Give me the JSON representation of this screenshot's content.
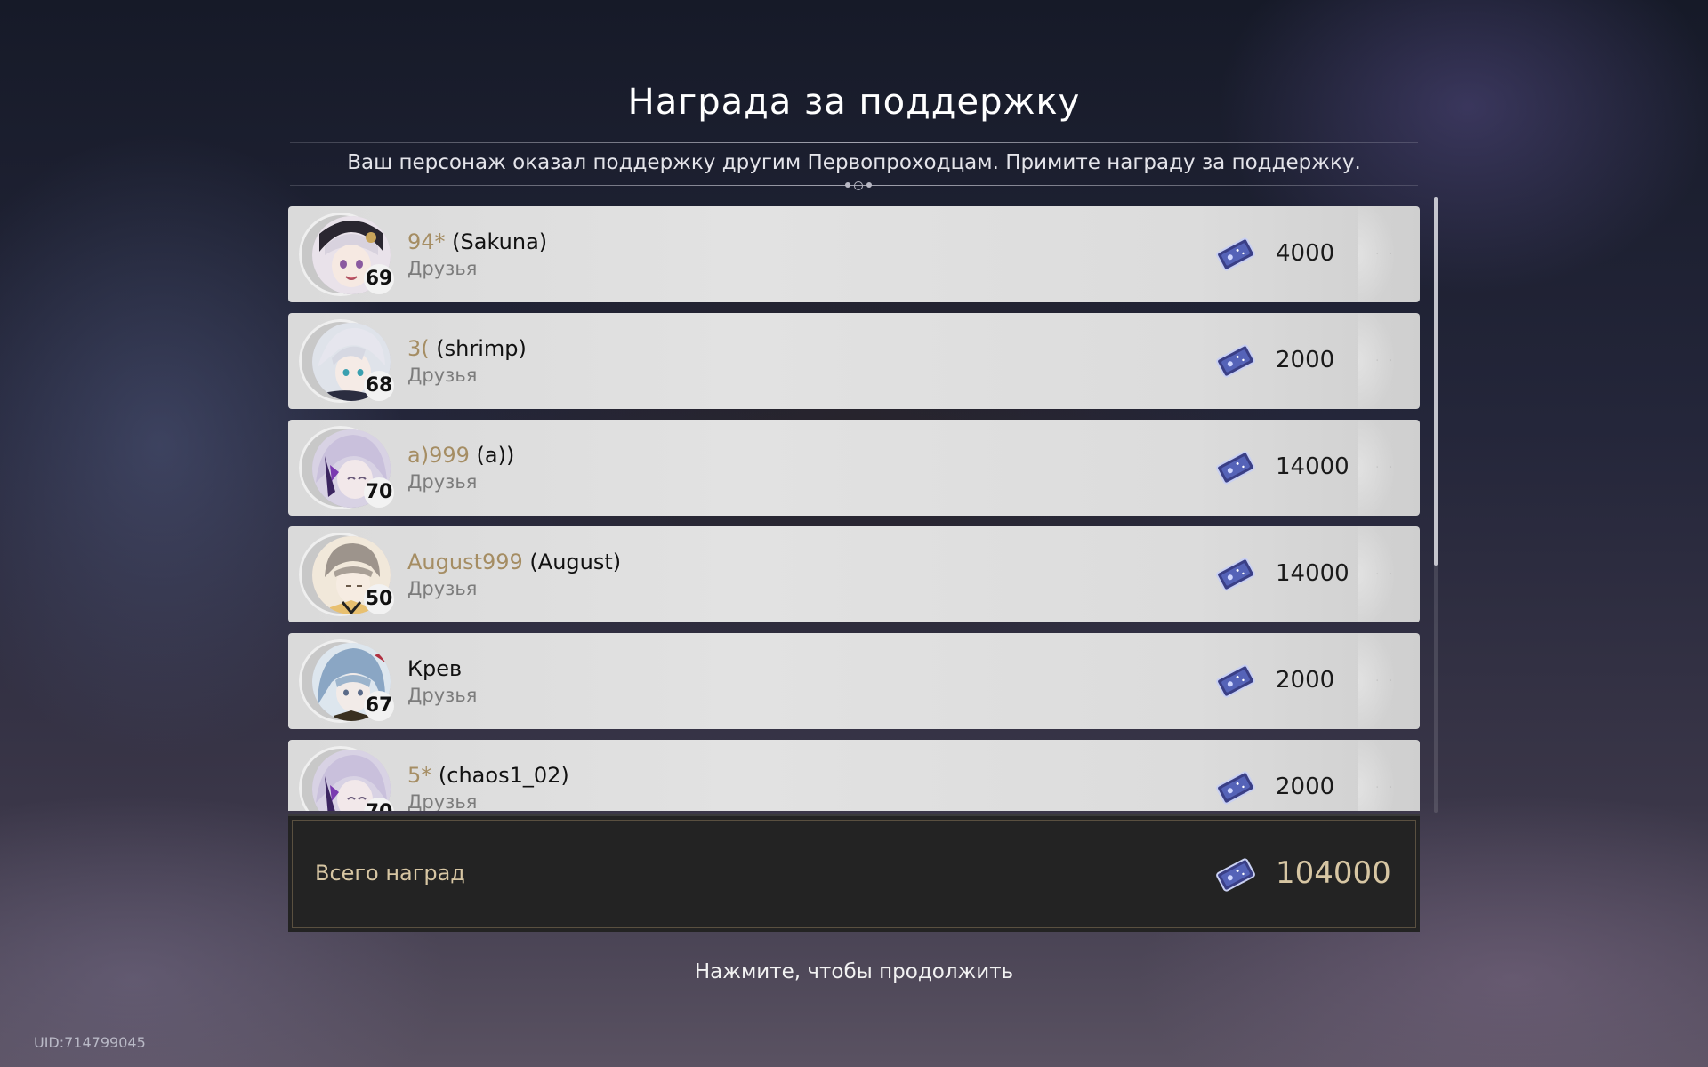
{
  "title": "Награда за поддержку",
  "subtitle": "Ваш персонаж оказал поддержку другим Первопроходцам. Примите награду за поддержку.",
  "reward_icon": "stellar-jade-ticket-icon",
  "rows": [
    {
      "nick": "94*",
      "name": " (Sakuna)",
      "relation": "Друзья",
      "level": "69",
      "amount": "4000"
    },
    {
      "nick": "3(",
      "name": " (shrimp)",
      "relation": "Друзья",
      "level": "68",
      "amount": "2000"
    },
    {
      "nick": "a)999",
      "name": " (a))",
      "relation": "Друзья",
      "level": "70",
      "amount": "14000"
    },
    {
      "nick": "August999",
      "name": " (August)",
      "relation": "Друзья",
      "level": "50",
      "amount": "14000"
    },
    {
      "nick": "",
      "name": "Крев",
      "relation": "Друзья",
      "level": "67",
      "amount": "2000"
    },
    {
      "nick": "5*",
      "name": " (chaos1_02)",
      "relation": "Друзья",
      "level": "70",
      "amount": "2000"
    }
  ],
  "total": {
    "label": "Всего наград",
    "amount": "104000"
  },
  "continue_text": "Нажмите, чтобы продолжить",
  "uid": "UID:714799045",
  "colors": {
    "nick": "#a58d63",
    "total_text": "#d7c6a3",
    "row_bg": "#dcdcdc",
    "panel_bg": "#232323"
  }
}
